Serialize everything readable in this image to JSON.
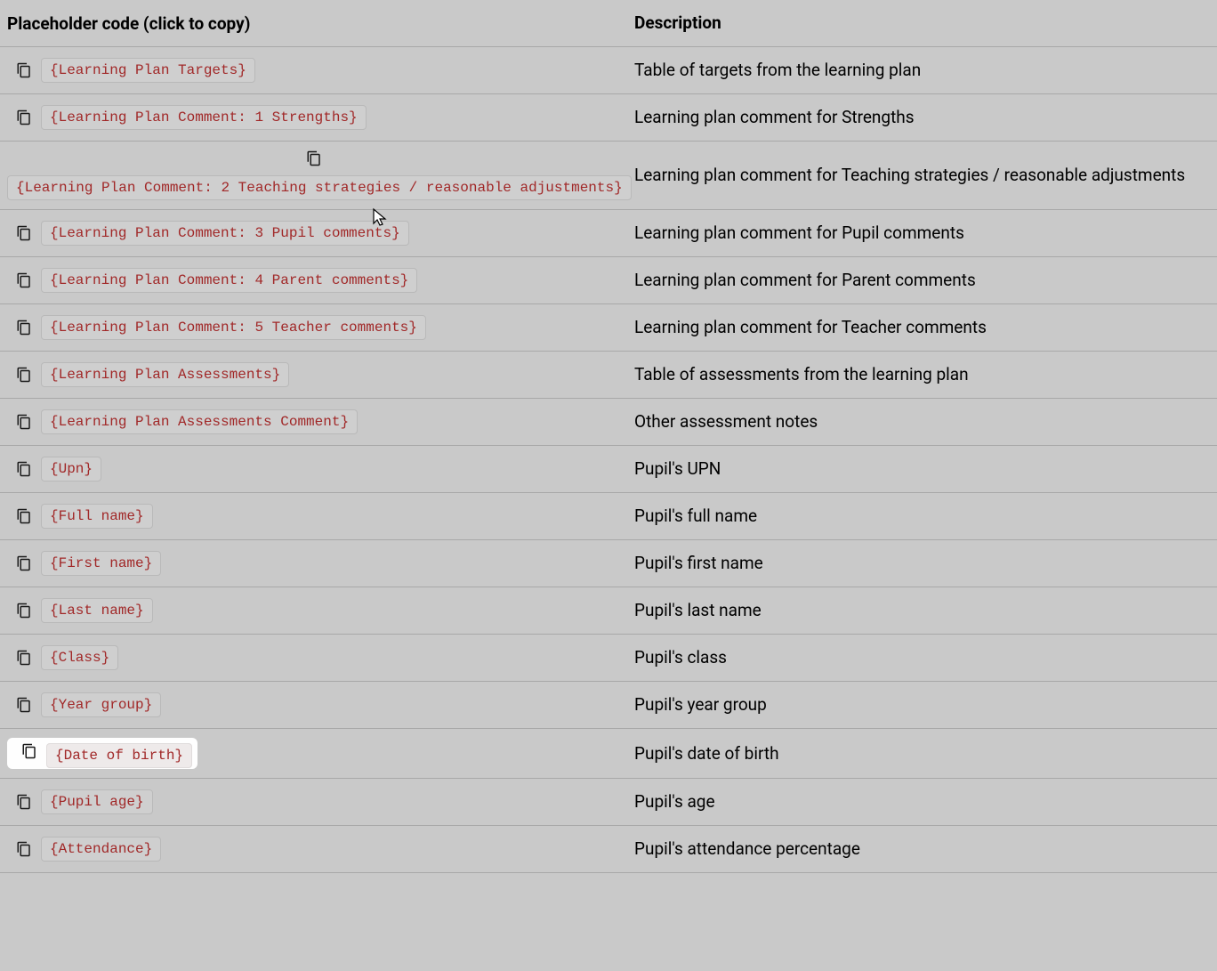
{
  "headers": {
    "code": "Placeholder code (click to copy)",
    "description": "Description"
  },
  "rows": [
    {
      "code": "{Learning Plan Targets}",
      "description": "Table of targets from the learning plan",
      "wrapped": false,
      "highlight": false
    },
    {
      "code": "{Learning Plan Comment: 1 Strengths}",
      "description": "Learning plan comment for Strengths",
      "wrapped": false,
      "highlight": false
    },
    {
      "code": "{Learning Plan Comment: 2 Teaching strategies / reasonable adjustments}",
      "description": "Learning plan comment for Teaching strategies / reasonable adjustments",
      "wrapped": true,
      "highlight": false
    },
    {
      "code": "{Learning Plan Comment: 3 Pupil comments}",
      "description": "Learning plan comment for Pupil comments",
      "wrapped": false,
      "highlight": false
    },
    {
      "code": "{Learning Plan Comment: 4 Parent comments}",
      "description": "Learning plan comment for Parent comments",
      "wrapped": false,
      "highlight": false
    },
    {
      "code": "{Learning Plan Comment: 5 Teacher comments}",
      "description": "Learning plan comment for Teacher comments",
      "wrapped": false,
      "highlight": false
    },
    {
      "code": "{Learning Plan Assessments}",
      "description": "Table of assessments from the learning plan",
      "wrapped": false,
      "highlight": false
    },
    {
      "code": "{Learning Plan Assessments Comment}",
      "description": "Other assessment notes",
      "wrapped": false,
      "highlight": false
    },
    {
      "code": "{Upn}",
      "description": "Pupil's UPN",
      "wrapped": false,
      "highlight": false
    },
    {
      "code": "{Full name}",
      "description": "Pupil's full name",
      "wrapped": false,
      "highlight": false
    },
    {
      "code": "{First name}",
      "description": "Pupil's first name",
      "wrapped": false,
      "highlight": false
    },
    {
      "code": "{Last name}",
      "description": "Pupil's last name",
      "wrapped": false,
      "highlight": false
    },
    {
      "code": "{Class}",
      "description": "Pupil's class",
      "wrapped": false,
      "highlight": false
    },
    {
      "code": "{Year group}",
      "description": "Pupil's year group",
      "wrapped": false,
      "highlight": false
    },
    {
      "code": "{Date of birth}",
      "description": "Pupil's date of birth",
      "wrapped": false,
      "highlight": true
    },
    {
      "code": "{Pupil age}",
      "description": "Pupil's age",
      "wrapped": false,
      "highlight": false
    },
    {
      "code": "{Attendance}",
      "description": "Pupil's attendance percentage",
      "wrapped": false,
      "highlight": false
    }
  ]
}
